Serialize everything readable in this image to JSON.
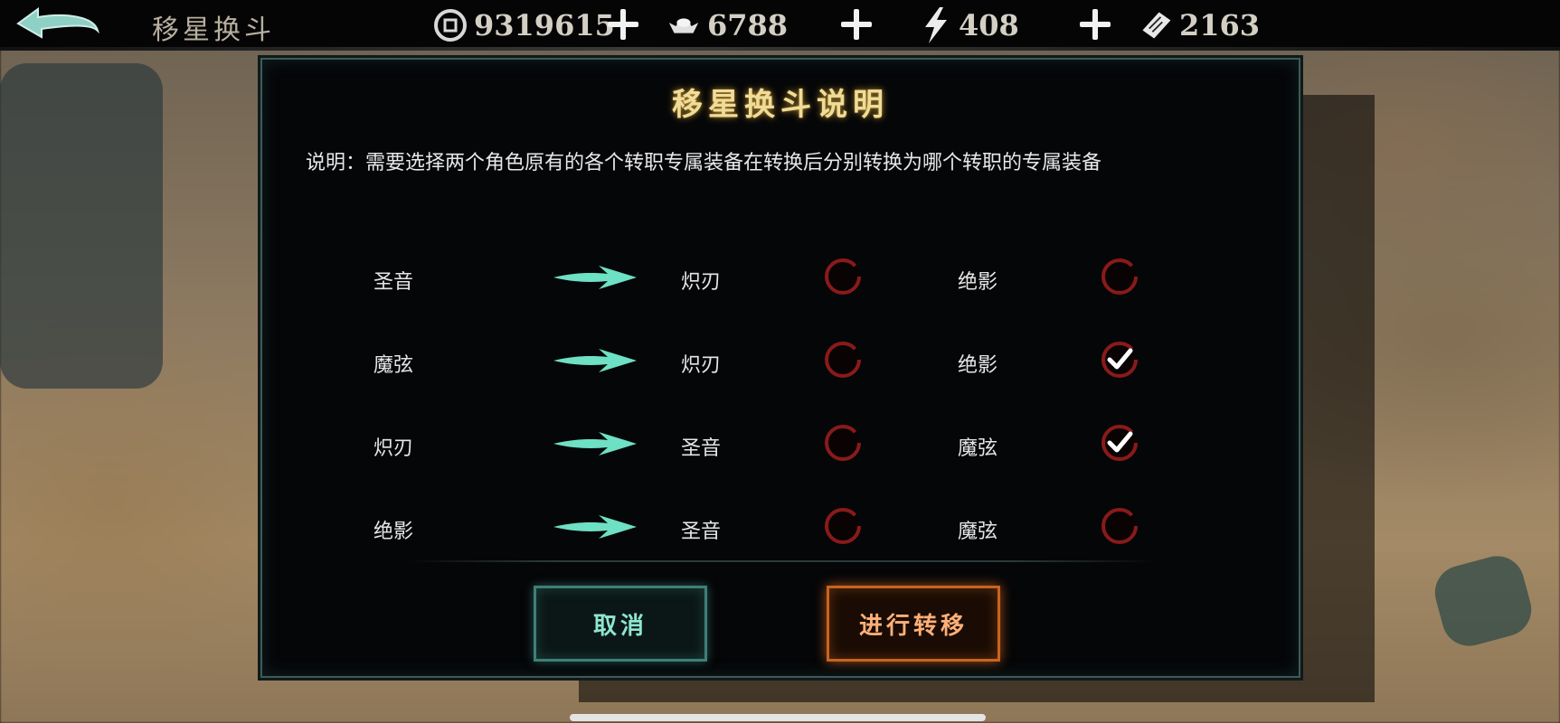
{
  "topbar": {
    "title": "移星换斗",
    "resources": [
      {
        "icon": "coin-icon",
        "value": "9319615"
      },
      {
        "icon": "silver-ingot-icon",
        "value": "6788"
      },
      {
        "icon": "lightning-energy-icon",
        "value": "408"
      },
      {
        "icon": "ticket-icon",
        "value": "2163"
      }
    ]
  },
  "dialog": {
    "title": "移星换斗说明",
    "description": "说明：需要选择两个角色原有的各个转职专属装备在转换后分别转换为哪个转职的专属装备",
    "rows": [
      {
        "source": "圣音",
        "option1": "炽刃",
        "option1_checked": false,
        "option2": "绝影",
        "option2_checked": false
      },
      {
        "source": "魔弦",
        "option1": "炽刃",
        "option1_checked": false,
        "option2": "绝影",
        "option2_checked": true
      },
      {
        "source": "炽刃",
        "option1": "圣音",
        "option1_checked": false,
        "option2": "魔弦",
        "option2_checked": true
      },
      {
        "source": "绝影",
        "option1": "圣音",
        "option1_checked": false,
        "option2": "魔弦",
        "option2_checked": false
      }
    ],
    "cancel_label": "取消",
    "confirm_label": "进行转移"
  },
  "colors": {
    "title_gold": "#f0dc9a",
    "check_ring_red": "#8a1a1a",
    "arrow_teal": "#6ee0c4",
    "cancel_teal": "#8ee6d0",
    "confirm_orange": "#ffb07a"
  }
}
